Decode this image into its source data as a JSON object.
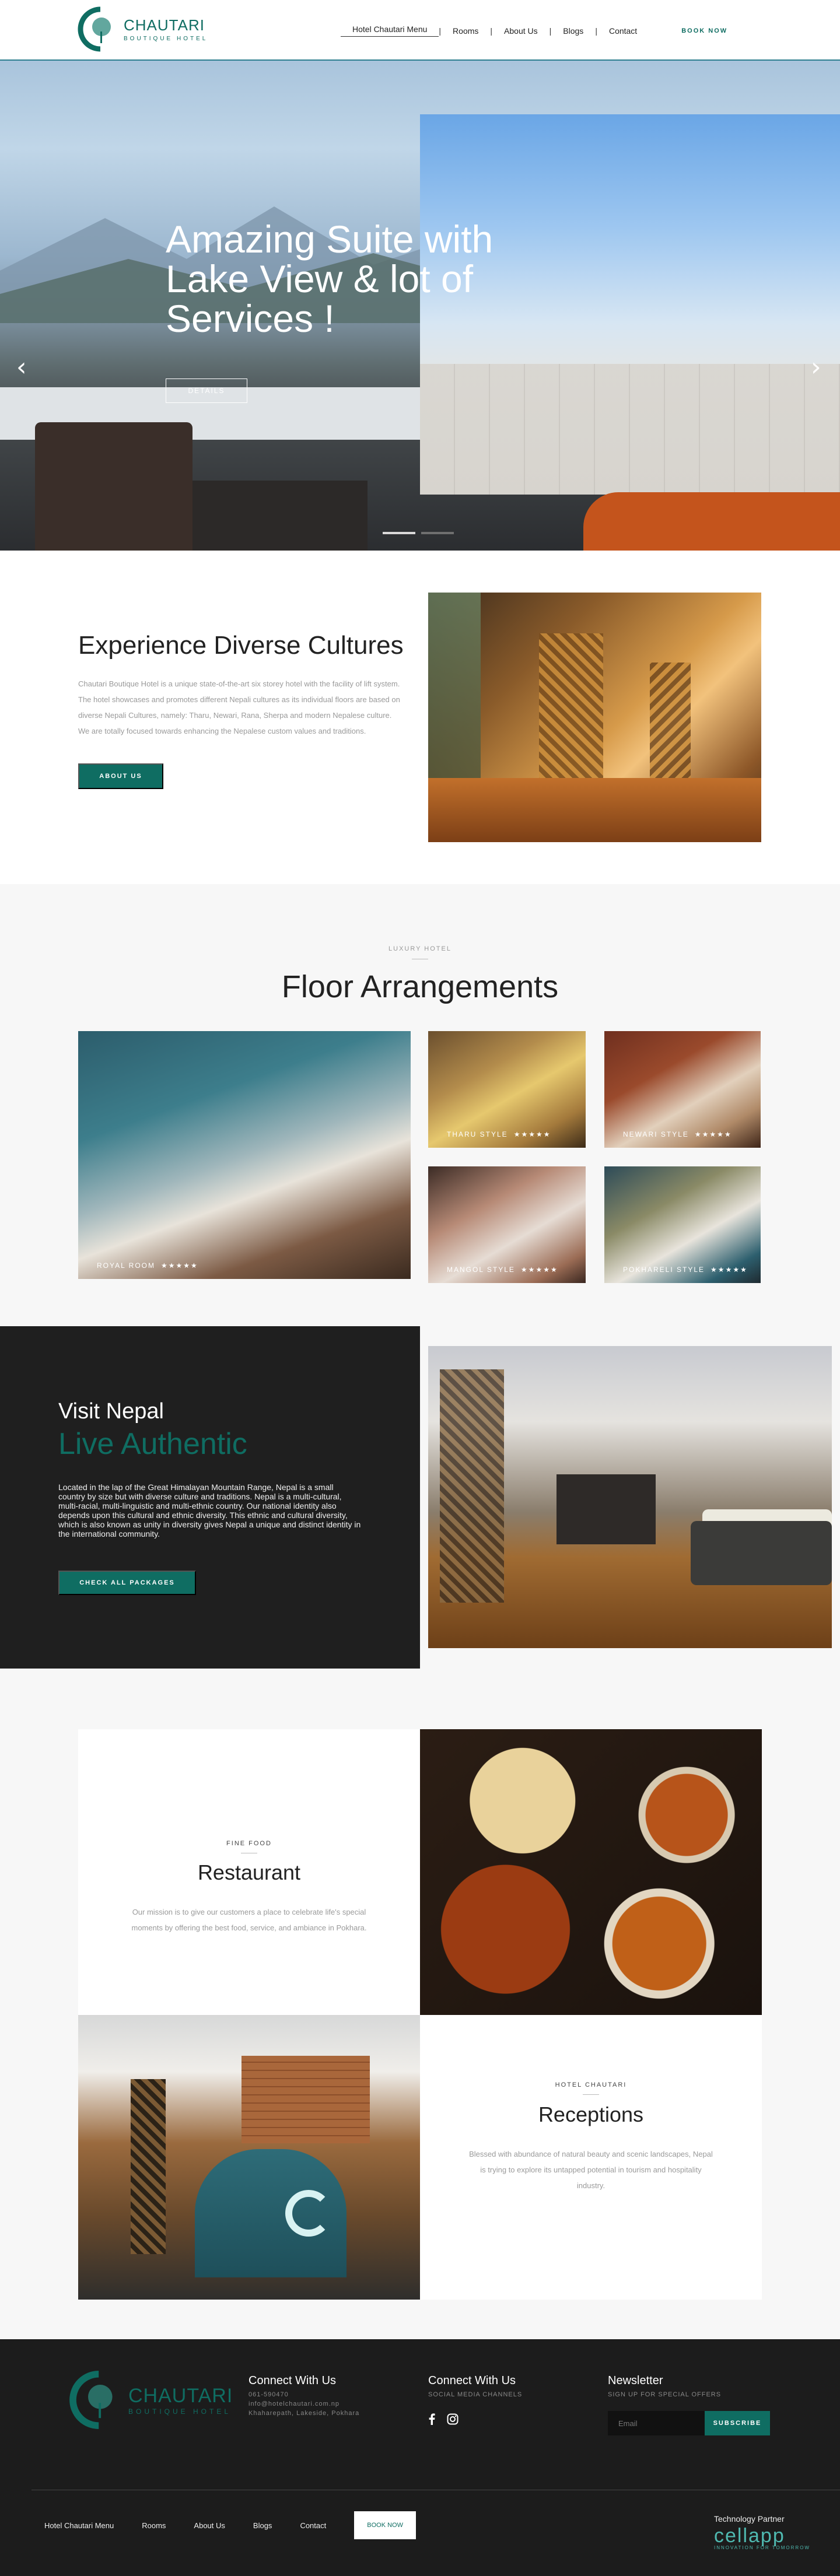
{
  "brand": {
    "name": "CHAUTARI",
    "tagline": "BOUTIQUE HOTEL",
    "color": "#0f6d62"
  },
  "nav": {
    "items": [
      "Hotel Chautari Menu",
      "Rooms",
      "About Us",
      "Blogs",
      "Contact"
    ],
    "book": "BOOK NOW"
  },
  "hero": {
    "title": "Amazing Suite with Lake View & lot of Services !",
    "button": "DETAILS",
    "prev_icon": "chevron-left-icon",
    "next_icon": "chevron-right-icon",
    "slide_count": 2,
    "active_slide": 1
  },
  "cultures": {
    "title": "Experience Diverse Cultures",
    "text": "Chautari Boutique Hotel is a unique state-of-the-art six storey hotel with the facility of lift system. The hotel showcases and promotes different Nepali cultures as its individual floors are based on diverse Nepali Cultures, namely: Tharu, Newari, Rana, Sherpa and modern Nepalese culture. We are totally focused towards enhancing the Nepalese custom values and traditions.",
    "button": "ABOUT US"
  },
  "floors": {
    "eyebrow": "LUXURY HOTEL",
    "title": "Floor Arrangements",
    "rooms": [
      {
        "label": "ROYAL ROOM",
        "stars": 5
      },
      {
        "label": "THARU STYLE",
        "stars": 5
      },
      {
        "label": "NEWARI STYLE",
        "stars": 5
      },
      {
        "label": "MANGOL STYLE",
        "stars": 5
      },
      {
        "label": "POKHARELI STYLE",
        "stars": 5
      }
    ]
  },
  "visit": {
    "line1": "Visit Nepal",
    "line2": "Live Authentic",
    "text": "Located in the lap of the Great Himalayan Mountain Range, Nepal is a small country by size but with diverse culture and traditions. Nepal is a multi-cultural, multi-racial, multi-linguistic and multi-ethnic country. Our national identity also depends upon this cultural and ethnic diversity. This ethnic and cultural diversity, which is also known as unity in diversity gives Nepal a unique and distinct identity in the international community.",
    "button": "CHECK ALL PACKAGES"
  },
  "restaurant": {
    "eyebrow": "FINE FOOD",
    "title": "Restaurant",
    "text": "Our mission is to give our customers a place to celebrate life's special moments by offering the best food, service, and ambiance in Pokhara."
  },
  "reception": {
    "eyebrow": "HOTEL CHAUTARI",
    "title": "Receptions",
    "text": "Blessed with abundance of natural beauty and scenic landscapes, Nepal is trying to explore its untapped potential in tourism and hospitality industry."
  },
  "footer": {
    "connect1": {
      "title": "Connect With Us",
      "phone": "061-590470",
      "email": "info@hotelchautari.com.np",
      "address": "Khaharepath, Lakeside, Pokhara"
    },
    "connect2": {
      "title": "Connect With Us",
      "sub": "SOCIAL MEDIA CHANNELS"
    },
    "newsletter": {
      "title": "Newsletter",
      "sub": "SIGN UP FOR SPECIAL OFFERS",
      "placeholder": "Email",
      "button": "SUBSCRIBE"
    },
    "nav": [
      "Hotel Chautari Menu",
      "Rooms",
      "About Us",
      "Blogs",
      "Contact"
    ],
    "book": "BOOK NOW",
    "partner_label": "Technology Partner",
    "partner_name": "cellapp",
    "partner_sub": "INNOVATION FOR TOMORROW"
  }
}
